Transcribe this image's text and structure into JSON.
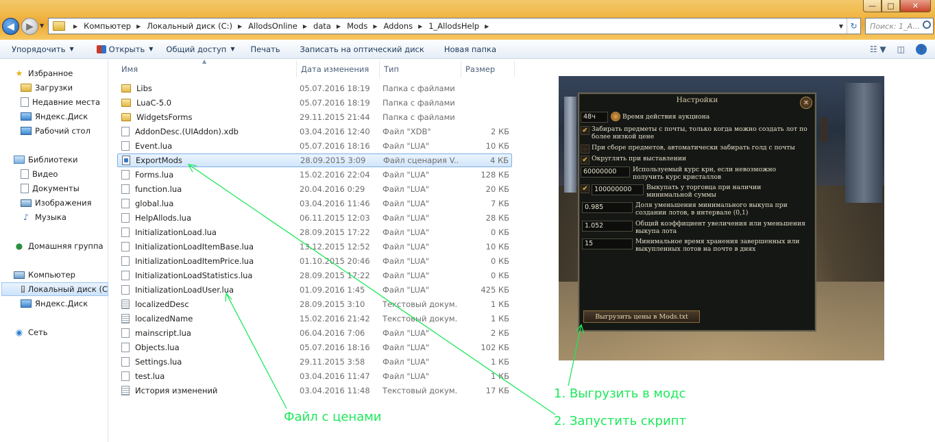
{
  "window": {
    "min": "—",
    "max": "□",
    "close": "✕"
  },
  "nav": {
    "breadcrumb": [
      "Компьютер",
      "Локальный диск (C:)",
      "AllodsOnline",
      "data",
      "Mods",
      "Addons",
      "1_AllodsHelp"
    ],
    "search_placeholder": "Поиск: 1_A..."
  },
  "toolbar": {
    "organize": "Упорядочить",
    "open": "Открыть",
    "share": "Общий доступ",
    "print": "Печать",
    "burn": "Записать на оптический диск",
    "new_folder": "Новая папка"
  },
  "sidebar": {
    "favorites": "Избранное",
    "downloads": "Загрузки",
    "recent": "Недавние места",
    "yadisk1": "Яндекс.Диск",
    "desktop": "Рабочий стол",
    "libraries": "Библиотеки",
    "video": "Видео",
    "documents": "Документы",
    "pictures": "Изображения",
    "music": "Музыка",
    "homegroup": "Домашняя группа",
    "computer": "Компьютер",
    "local_disk": "Локальный диск (С",
    "yadisk2": "Яндекс.Диск",
    "network": "Сеть"
  },
  "columns": {
    "name": "Имя",
    "date": "Дата изменения",
    "type": "Тип",
    "size": "Размер"
  },
  "files": [
    {
      "name": "Libs",
      "date": "05.07.2016 18:19",
      "type": "Папка с файлами",
      "size": "",
      "icon": "folder"
    },
    {
      "name": "LuaC-5.0",
      "date": "05.07.2016 18:19",
      "type": "Папка с файлами",
      "size": "",
      "icon": "folder"
    },
    {
      "name": "WidgetsForms",
      "date": "29.11.2015 21:44",
      "type": "Папка с файлами",
      "size": "",
      "icon": "folder"
    },
    {
      "name": "AddonDesc.(UIAddon).xdb",
      "date": "03.04.2016 12:40",
      "type": "Файл \"XDB\"",
      "size": "2 КБ",
      "icon": "file"
    },
    {
      "name": "Event.lua",
      "date": "05.07.2016 18:16",
      "type": "Файл \"LUA\"",
      "size": "10 КБ",
      "icon": "file"
    },
    {
      "name": "ExportMods",
      "date": "28.09.2015 3:09",
      "type": "Файл сценария V...",
      "size": "4 КБ",
      "icon": "script"
    },
    {
      "name": "Forms.lua",
      "date": "15.02.2016 22:04",
      "type": "Файл \"LUA\"",
      "size": "128 КБ",
      "icon": "file"
    },
    {
      "name": "function.lua",
      "date": "20.04.2016 0:29",
      "type": "Файл \"LUA\"",
      "size": "20 КБ",
      "icon": "file"
    },
    {
      "name": "global.lua",
      "date": "03.04.2016 11:46",
      "type": "Файл \"LUA\"",
      "size": "7 КБ",
      "icon": "file"
    },
    {
      "name": "HelpAllods.lua",
      "date": "06.11.2015 12:03",
      "type": "Файл \"LUA\"",
      "size": "28 КБ",
      "icon": "file"
    },
    {
      "name": "InitializationLoad.lua",
      "date": "28.09.2015 17:22",
      "type": "Файл \"LUA\"",
      "size": "0 КБ",
      "icon": "file"
    },
    {
      "name": "InitializationLoadItemBase.lua",
      "date": "13.12.2015 12:52",
      "type": "Файл \"LUA\"",
      "size": "10 КБ",
      "icon": "file"
    },
    {
      "name": "InitializationLoadItemPrice.lua",
      "date": "01.10.2015 20:46",
      "type": "Файл \"LUA\"",
      "size": "0 КБ",
      "icon": "file"
    },
    {
      "name": "InitializationLoadStatistics.lua",
      "date": "28.09.2015 17:22",
      "type": "Файл \"LUA\"",
      "size": "0 КБ",
      "icon": "file"
    },
    {
      "name": "InitializationLoadUser.lua",
      "date": "01.09.2016 1:45",
      "type": "Файл \"LUA\"",
      "size": "425 КБ",
      "icon": "file"
    },
    {
      "name": "localizedDesc",
      "date": "28.09.2015 3:10",
      "type": "Текстовый докум...",
      "size": "1 КБ",
      "icon": "text"
    },
    {
      "name": "localizedName",
      "date": "15.02.2016 21:42",
      "type": "Текстовый докум...",
      "size": "1 КБ",
      "icon": "text"
    },
    {
      "name": "mainscript.lua",
      "date": "06.04.2016 7:06",
      "type": "Файл \"LUA\"",
      "size": "2 КБ",
      "icon": "file"
    },
    {
      "name": "Objects.lua",
      "date": "05.07.2016 18:16",
      "type": "Файл \"LUA\"",
      "size": "102 КБ",
      "icon": "file"
    },
    {
      "name": "Settings.lua",
      "date": "29.11.2015 3:58",
      "type": "Файл \"LUA\"",
      "size": "1 КБ",
      "icon": "file"
    },
    {
      "name": "test.lua",
      "date": "03.04.2016 11:47",
      "type": "Файл \"LUA\"",
      "size": "1 КБ",
      "icon": "file"
    },
    {
      "name": "История изменений",
      "date": "03.04.2016 11:48",
      "type": "Текстовый докум...",
      "size": "17 КБ",
      "icon": "text"
    }
  ],
  "game_panel": {
    "title": "Настройки",
    "close": "✕",
    "auction_value": "48ч",
    "auction_label": "Время действия аукциона",
    "opt1": "Забирать предметы с почты, только когда можно создать лот по более низкой цене",
    "opt2": "При сборе предметов, автоматически забирать голд с почты",
    "opt3": "Округлять при выставлении",
    "rate_value": "60000000",
    "rate_label": "Используемый курс крн, если невозможно получить курс кристаллов",
    "buyout_value": "100000000",
    "buyout_label": "Выкупать у торговца при наличии минимальной суммы",
    "factor1_value": "0.985",
    "factor1_label": "Доля уменьшения минимального выкупа при создании лотов, в интервале (0,1)",
    "factor2_value": "1.052",
    "factor2_label": "Общий коэффициент увеличения или уменьшения выкупа лота",
    "days_value": "15",
    "days_label": "Минимальное время хранения завершенных или выкупленных лотов на почте в днях",
    "export_button": "Выгрузить цены в Mods.txt"
  },
  "annotations": {
    "step1": "1. Выгрузить в модс",
    "step2": "2. Запустить скрипт",
    "prices_file": "Файл с ценами",
    "color": "#1de85a"
  }
}
